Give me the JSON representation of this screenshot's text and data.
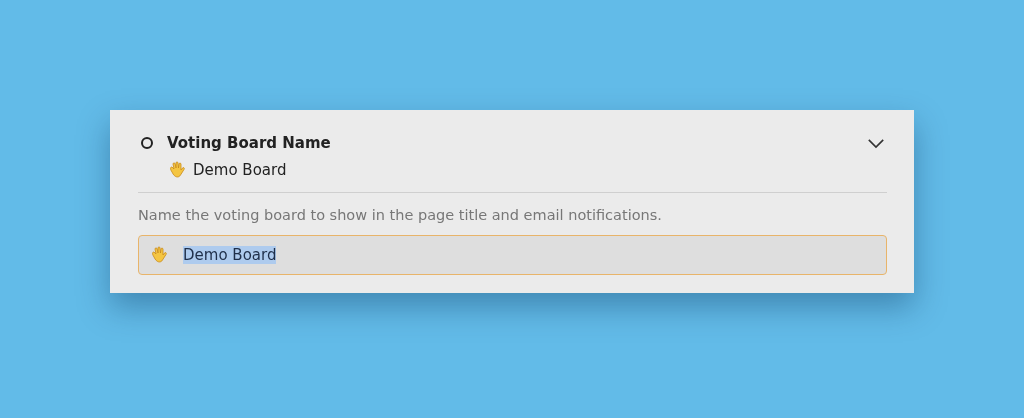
{
  "setting": {
    "title": "Voting Board Name",
    "done": false,
    "expanded": true,
    "summary_value": "Demo Board"
  },
  "description": "Name the voting board to show in the page title and email notifications.",
  "name_field": {
    "value": "Demo Board",
    "focused": true,
    "text_selected": true
  }
}
